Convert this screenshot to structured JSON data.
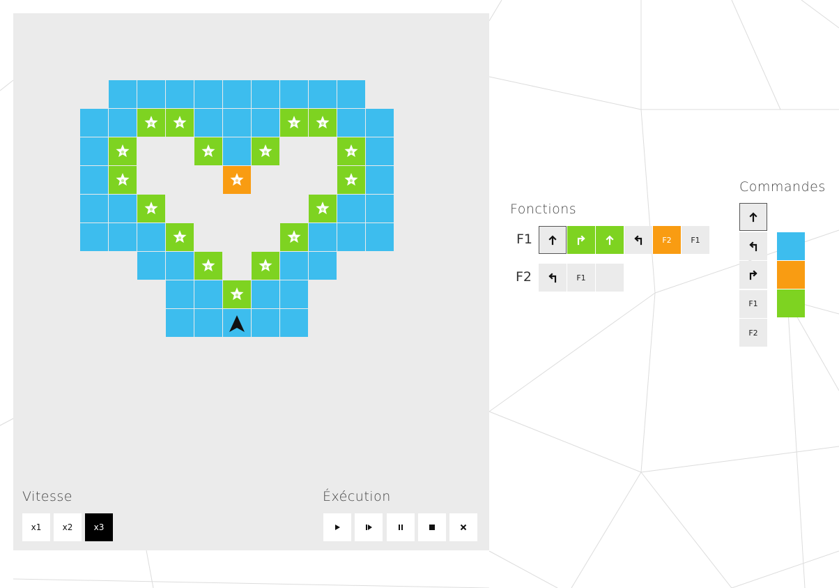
{
  "board": {
    "ship_cell": [
      5,
      8
    ],
    "rows": [
      "-BBBBBBBBB-",
      "BBGGBBBGGBB",
      "BG.GBG..GB",
      "BG..O...GB",
      "BBG....GBB",
      "BBBG..GBBB",
      "--BBG.GBB",
      "---BBGBB",
      "---BBBBB"
    ],
    "cells": [
      {
        "row": 0,
        "cols": [
          1,
          2,
          3,
          4,
          5,
          6,
          7,
          8,
          9
        ],
        "color": "blue"
      },
      {
        "row": 1,
        "cols": [
          0,
          1,
          4,
          5,
          6,
          9,
          10
        ],
        "color": "blue"
      },
      {
        "row": 1,
        "cols": [
          2,
          3,
          7,
          8
        ],
        "color": "green",
        "star": true
      },
      {
        "row": 2,
        "cols": [
          0,
          5,
          10
        ],
        "color": "blue"
      },
      {
        "row": 2,
        "cols": [
          1,
          4,
          6,
          9
        ],
        "color": "green",
        "star": true
      },
      {
        "row": 3,
        "cols": [
          0,
          10
        ],
        "color": "blue"
      },
      {
        "row": 3,
        "cols": [
          1,
          9
        ],
        "color": "green",
        "star": true
      },
      {
        "row": 3,
        "cols": [
          5
        ],
        "color": "orange",
        "star": true
      },
      {
        "row": 4,
        "cols": [
          0,
          1,
          9,
          10
        ],
        "color": "blue"
      },
      {
        "row": 4,
        "cols": [
          2,
          8
        ],
        "color": "green",
        "star": true
      },
      {
        "row": 5,
        "cols": [
          0,
          1,
          2,
          8,
          9,
          10
        ],
        "color": "blue"
      },
      {
        "row": 5,
        "cols": [
          3,
          7
        ],
        "color": "green",
        "star": true
      },
      {
        "row": 6,
        "cols": [
          2,
          3,
          7,
          8
        ],
        "color": "blue"
      },
      {
        "row": 6,
        "cols": [
          4,
          6
        ],
        "color": "green",
        "star": true
      },
      {
        "row": 7,
        "cols": [
          3,
          4,
          6,
          7
        ],
        "color": "blue"
      },
      {
        "row": 7,
        "cols": [
          5
        ],
        "color": "green",
        "star": true
      },
      {
        "row": 8,
        "cols": [
          3,
          4,
          5,
          6,
          7
        ],
        "color": "blue"
      }
    ]
  },
  "speed": {
    "label": "Vitesse",
    "options": [
      "x1",
      "x2",
      "x3"
    ],
    "selected": "x3"
  },
  "execution": {
    "label": "Éxécution",
    "buttons": [
      "play-icon",
      "step-icon",
      "pause-icon",
      "stop-icon",
      "clear-icon"
    ]
  },
  "functions": {
    "label": "Fonctions",
    "rows": [
      {
        "name": "F1",
        "slots": [
          {
            "cmd": "forward",
            "color": "none",
            "selected": true
          },
          {
            "cmd": "right",
            "color": "green"
          },
          {
            "cmd": "forward",
            "color": "green"
          },
          {
            "cmd": "left",
            "color": "none"
          },
          {
            "cmd": "F2",
            "color": "orange"
          },
          {
            "cmd": "F1",
            "color": "none"
          }
        ]
      },
      {
        "name": "F2",
        "slots": [
          {
            "cmd": "left",
            "color": "none"
          },
          {
            "cmd": "F1",
            "color": "none"
          },
          {
            "cmd": "",
            "color": "none"
          }
        ]
      }
    ]
  },
  "commands": {
    "label": "Commandes",
    "items": [
      {
        "cmd": "forward",
        "selected": true
      },
      {
        "cmd": "left"
      },
      {
        "cmd": "right"
      },
      {
        "cmd": "F1"
      },
      {
        "cmd": "F2"
      }
    ],
    "colors": [
      "#3dbdee",
      "#f99c12",
      "#7ed321"
    ]
  },
  "palette": {
    "blue": "#3dbdee",
    "green": "#7ed321",
    "orange": "#f99c12",
    "panel": "#ebebeb"
  }
}
